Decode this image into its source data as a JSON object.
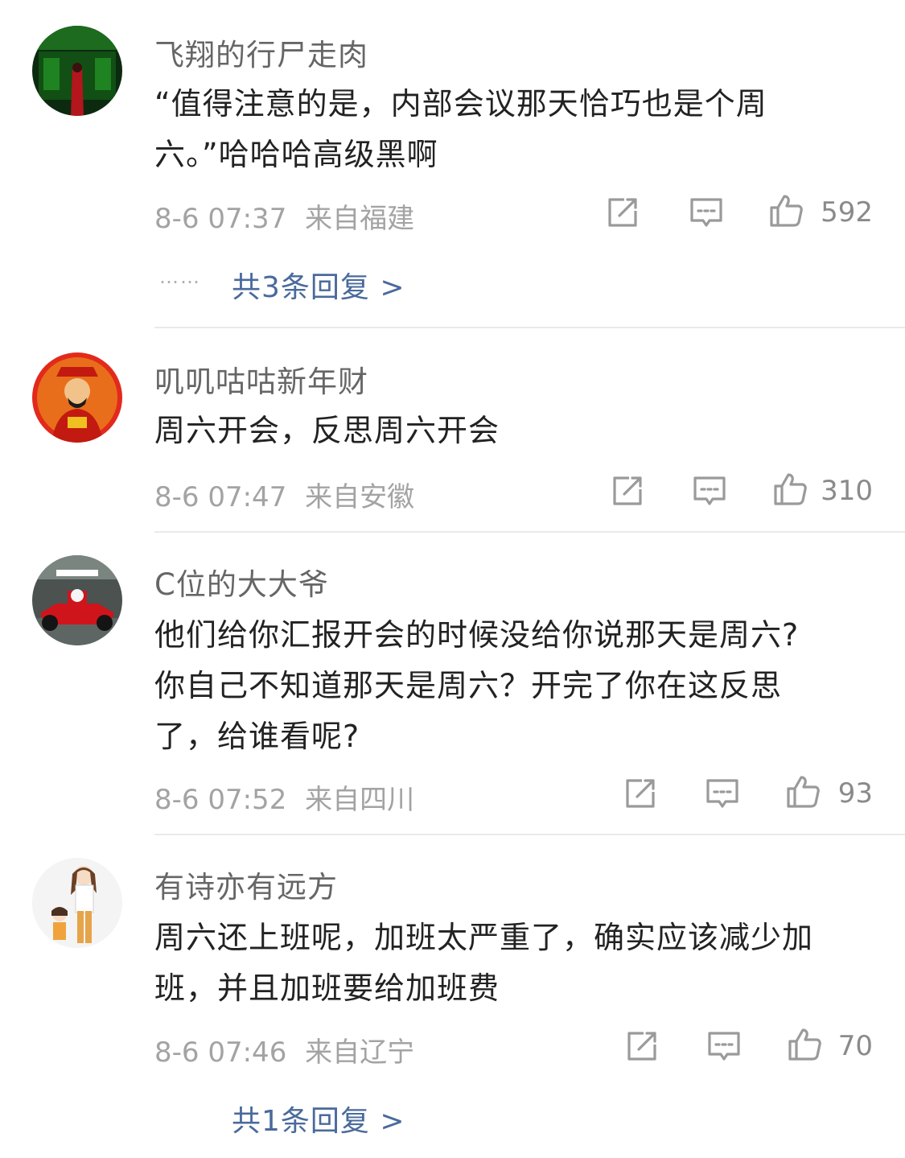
{
  "colors": {
    "link": "#4a6a9c",
    "meta": "#a3a3a3",
    "icon": "#999999"
  },
  "comments": [
    {
      "username": "飞翔的行尸走肉",
      "text_lines": [
        "“值得注意的是，内部会议那天恰巧也是个周",
        "六。”哈哈哈高级黑啊"
      ],
      "time": "8-6 07:37",
      "location": "来自福建",
      "likes": "592",
      "replies_dots": "……",
      "replies_text": "共3条回复 >"
    },
    {
      "username": "叽叽咕咕新年财",
      "text_lines": [
        "周六开会，反思周六开会"
      ],
      "time": "8-6 07:47",
      "location": "来自安徽",
      "likes": "310"
    },
    {
      "username": "C位的大大爷",
      "text_lines": [
        "他们给你汇报开会的时候没给你说那天是周六?",
        "你自己不知道那天是周六？开完了你在这反思",
        "了，给谁看呢?"
      ],
      "time": "8-6 07:52",
      "location": "来自四川",
      "likes": "93"
    },
    {
      "username": "有诗亦有远方",
      "text_lines": [
        "周六还上班呢，加班太严重了，确实应该减少加",
        "班，并且加班要给加班费"
      ],
      "time": "8-6 07:46",
      "location": "来自辽宁",
      "likes": "70",
      "replies_text": "共1条回复 >"
    }
  ],
  "icons": {
    "repost": "repost-icon",
    "comment": "comment-icon",
    "like": "like-icon"
  }
}
